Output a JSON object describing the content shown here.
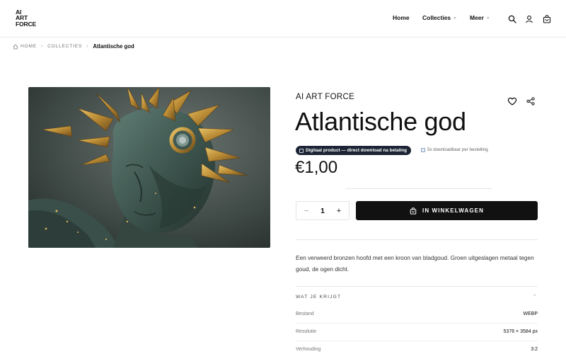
{
  "header": {
    "logo_lines": [
      "AI",
      "ART",
      "FORCE"
    ],
    "nav": {
      "home": "Home",
      "collecties": "Collecties",
      "meer": "Meer"
    },
    "icons": [
      "search-icon",
      "user-icon",
      "bag-icon"
    ]
  },
  "breadcrumb": {
    "home": "HOME",
    "collecties": "COLLECTIES",
    "current": "Atlantische god"
  },
  "product": {
    "brand": "AI ART FORCE",
    "title": "Atlantische god",
    "badge": "Digitaal product — direct download na betaling",
    "download_note": "5x downloadbaar per bestelling",
    "price": "€1,00",
    "quantity": "1",
    "qty_minus": "−",
    "qty_plus": "+",
    "add_to_cart": "IN WINKELWAGEN",
    "description": "Een verweerd bronzen hoofd met een kroon van bladgoud. Groen uitgeslagen metaal tegen goud, de ogen dicht.",
    "accordion_title": "WAT JE KRIJGT",
    "specs": [
      {
        "key": "Bestand",
        "value": "WEBP"
      },
      {
        "key": "Resolutie",
        "value": "5376 × 3584 px"
      },
      {
        "key": "Verhouding",
        "value": "3:2"
      }
    ]
  },
  "colors": {
    "primary_button": "#111111",
    "badge_bg": "#1c2435",
    "gold": "#c9a046",
    "verdigris": "#4f6b63"
  }
}
